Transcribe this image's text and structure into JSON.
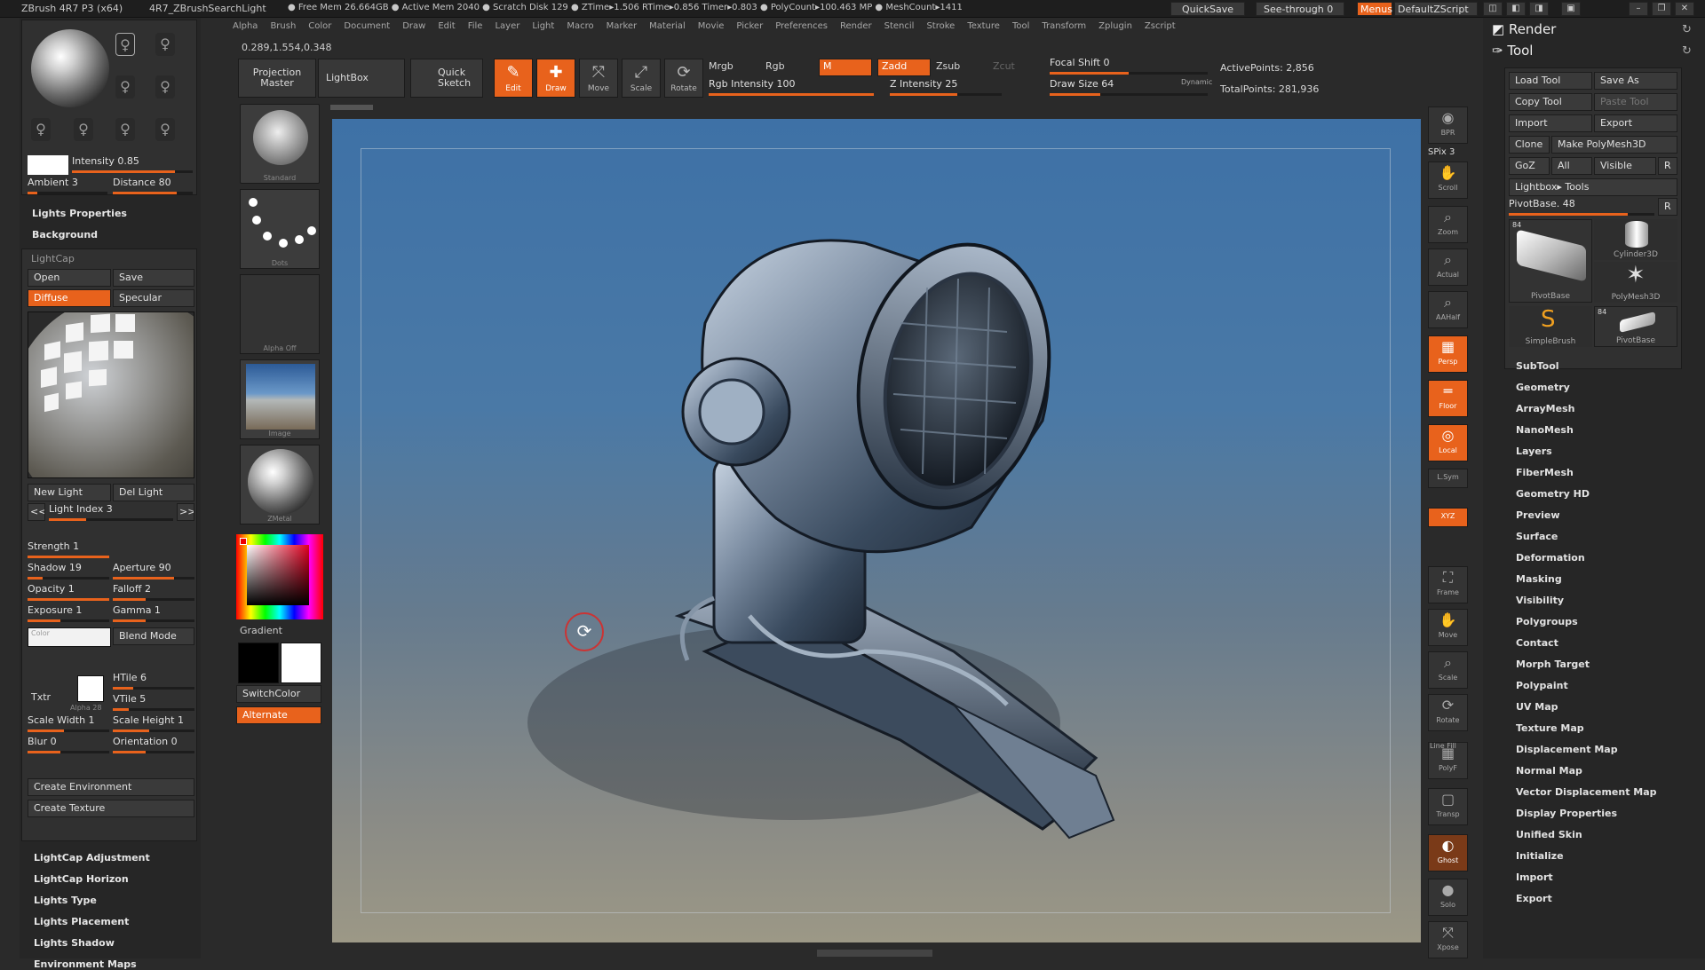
{
  "titlebar": {
    "app": "ZBrush 4R7 P3 (x64)",
    "doc": "4R7_ZBrushSearchLight",
    "stats": "● Free Mem 26.664GB ● Active Mem 2040 ● Scratch Disk 129 ● ZTime▸1.506 RTime▸0.856 Timer▸0.803 ● PolyCount▸100.463 MP ● MeshCount▸1411",
    "quicksave": "QuickSave",
    "seethrough": "See-through  0",
    "menus": "Menus",
    "script": "DefaultZScript"
  },
  "menubar": [
    "Alpha",
    "Brush",
    "Color",
    "Document",
    "Draw",
    "Edit",
    "File",
    "Layer",
    "Light",
    "Macro",
    "Marker",
    "Material",
    "Movie",
    "Picker",
    "Preferences",
    "Render",
    "Stencil",
    "Stroke",
    "Texture",
    "Tool",
    "Transform",
    "Zplugin",
    "Zscript"
  ],
  "coords": "0.289,1.554,0.348",
  "light": {
    "intensity": "Intensity 0.85",
    "intensity_v": 0.85,
    "ambient": "Ambient 3",
    "distance": "Distance 80",
    "lights_properties": "Lights Properties",
    "background": "Background",
    "lightcap": "LightCap",
    "open": "Open",
    "save": "Save",
    "diffuse": "Diffuse",
    "specular": "Specular",
    "new_light": "New Light",
    "del_light": "Del Light",
    "light_index": "Light Index 3",
    "prev": "<<",
    "next": ">>",
    "strength": "Strength 1",
    "shadow": "Shadow 19",
    "aperture": "Aperture 90",
    "opacity": "Opacity 1",
    "falloff": "Falloff 2",
    "exposure": "Exposure 1",
    "gamma": "Gamma 1",
    "color": "Color",
    "blend_mode": "Blend Mode",
    "txtr": "Txtr",
    "alpha": "Alpha 28",
    "htile": "HTile 6",
    "vtile": "VTile 5",
    "scale_width": "Scale Width 1",
    "scale_height": "Scale Height 1",
    "blur": "Blur 0",
    "orientation": "Orientation 0",
    "create_env": "Create Environment",
    "create_tex": "Create Texture",
    "sections": [
      "LightCap Adjustment",
      "LightCap Horizon",
      "Lights Type",
      "Lights Placement",
      "Lights Shadow",
      "Environment Maps"
    ]
  },
  "midcol": {
    "standard": "Standard",
    "dots": "Dots",
    "alpha_off": "Alpha  Off",
    "image": "Image",
    "zmetal": "ZMetal",
    "gradient": "Gradient",
    "switchcolor": "SwitchColor",
    "alternate": "Alternate"
  },
  "toolbar": {
    "projection_master": "Projection Master",
    "lightbox": "LightBox",
    "quick_sketch": "Quick Sketch",
    "edit": "Edit",
    "draw": "Draw",
    "move": "Move",
    "scale": "Scale",
    "rotate": "Rotate",
    "mrgb": "Mrgb",
    "rgb": "Rgb",
    "m": "M",
    "zadd": "Zadd",
    "zsub": "Zsub",
    "zcut": "Zcut",
    "rgb_intensity": "Rgb Intensity 100",
    "z_intensity": "Z Intensity 25",
    "focal_shift": "Focal Shift 0",
    "draw_size": "Draw Size 64",
    "dynamic": "Dynamic",
    "active_points": "ActivePoints: 2,856",
    "total_points": "TotalPoints: 281,936"
  },
  "righttools": [
    "BPR",
    "Scroll",
    "Zoom",
    "Actual",
    "AAHalf",
    "Persp",
    "Floor",
    "Local",
    "L.Sym",
    "XYZ",
    "Frame",
    "Move",
    "Scale",
    "Rotate",
    "PolyF",
    "Transp",
    "Ghost",
    "Solo",
    "Xpose"
  ],
  "spix": "SPix 3",
  "line_fill": "Line Fill",
  "rightpanel": {
    "render": "Render",
    "tool": "Tool",
    "load_tool": "Load Tool",
    "save_as": "Save As",
    "copy_tool": "Copy Tool",
    "paste_tool": "Paste Tool",
    "import": "Import",
    "export": "Export",
    "clone": "Clone",
    "make_polymesh": "Make PolyMesh3D",
    "goz": "GoZ",
    "all": "All",
    "visible": "Visible",
    "r": "R",
    "lightbox_tools": "Lightbox▸ Tools",
    "pivotbase": "PivotBase. 48",
    "thumbs": [
      {
        "num": "84",
        "label": "PivotBase"
      },
      {
        "num": "",
        "label": "Cylinder3D"
      },
      {
        "num": "",
        "label": "PolyMesh3D"
      },
      {
        "num": "",
        "label": "SimpleBrush"
      },
      {
        "num": "84",
        "label": "PivotBase"
      }
    ],
    "menu": [
      "SubTool",
      "Geometry",
      "ArrayMesh",
      "NanoMesh",
      "Layers",
      "FiberMesh",
      "Geometry HD",
      "Preview",
      "Surface",
      "Deformation",
      "Masking",
      "Visibility",
      "Polygroups",
      "Contact",
      "Morph Target",
      "Polypaint",
      "UV Map",
      "Texture Map",
      "Displacement Map",
      "Normal Map",
      "Vector Displacement Map",
      "Display Properties",
      "Unified Skin",
      "Initialize",
      "Import",
      "Export"
    ]
  }
}
